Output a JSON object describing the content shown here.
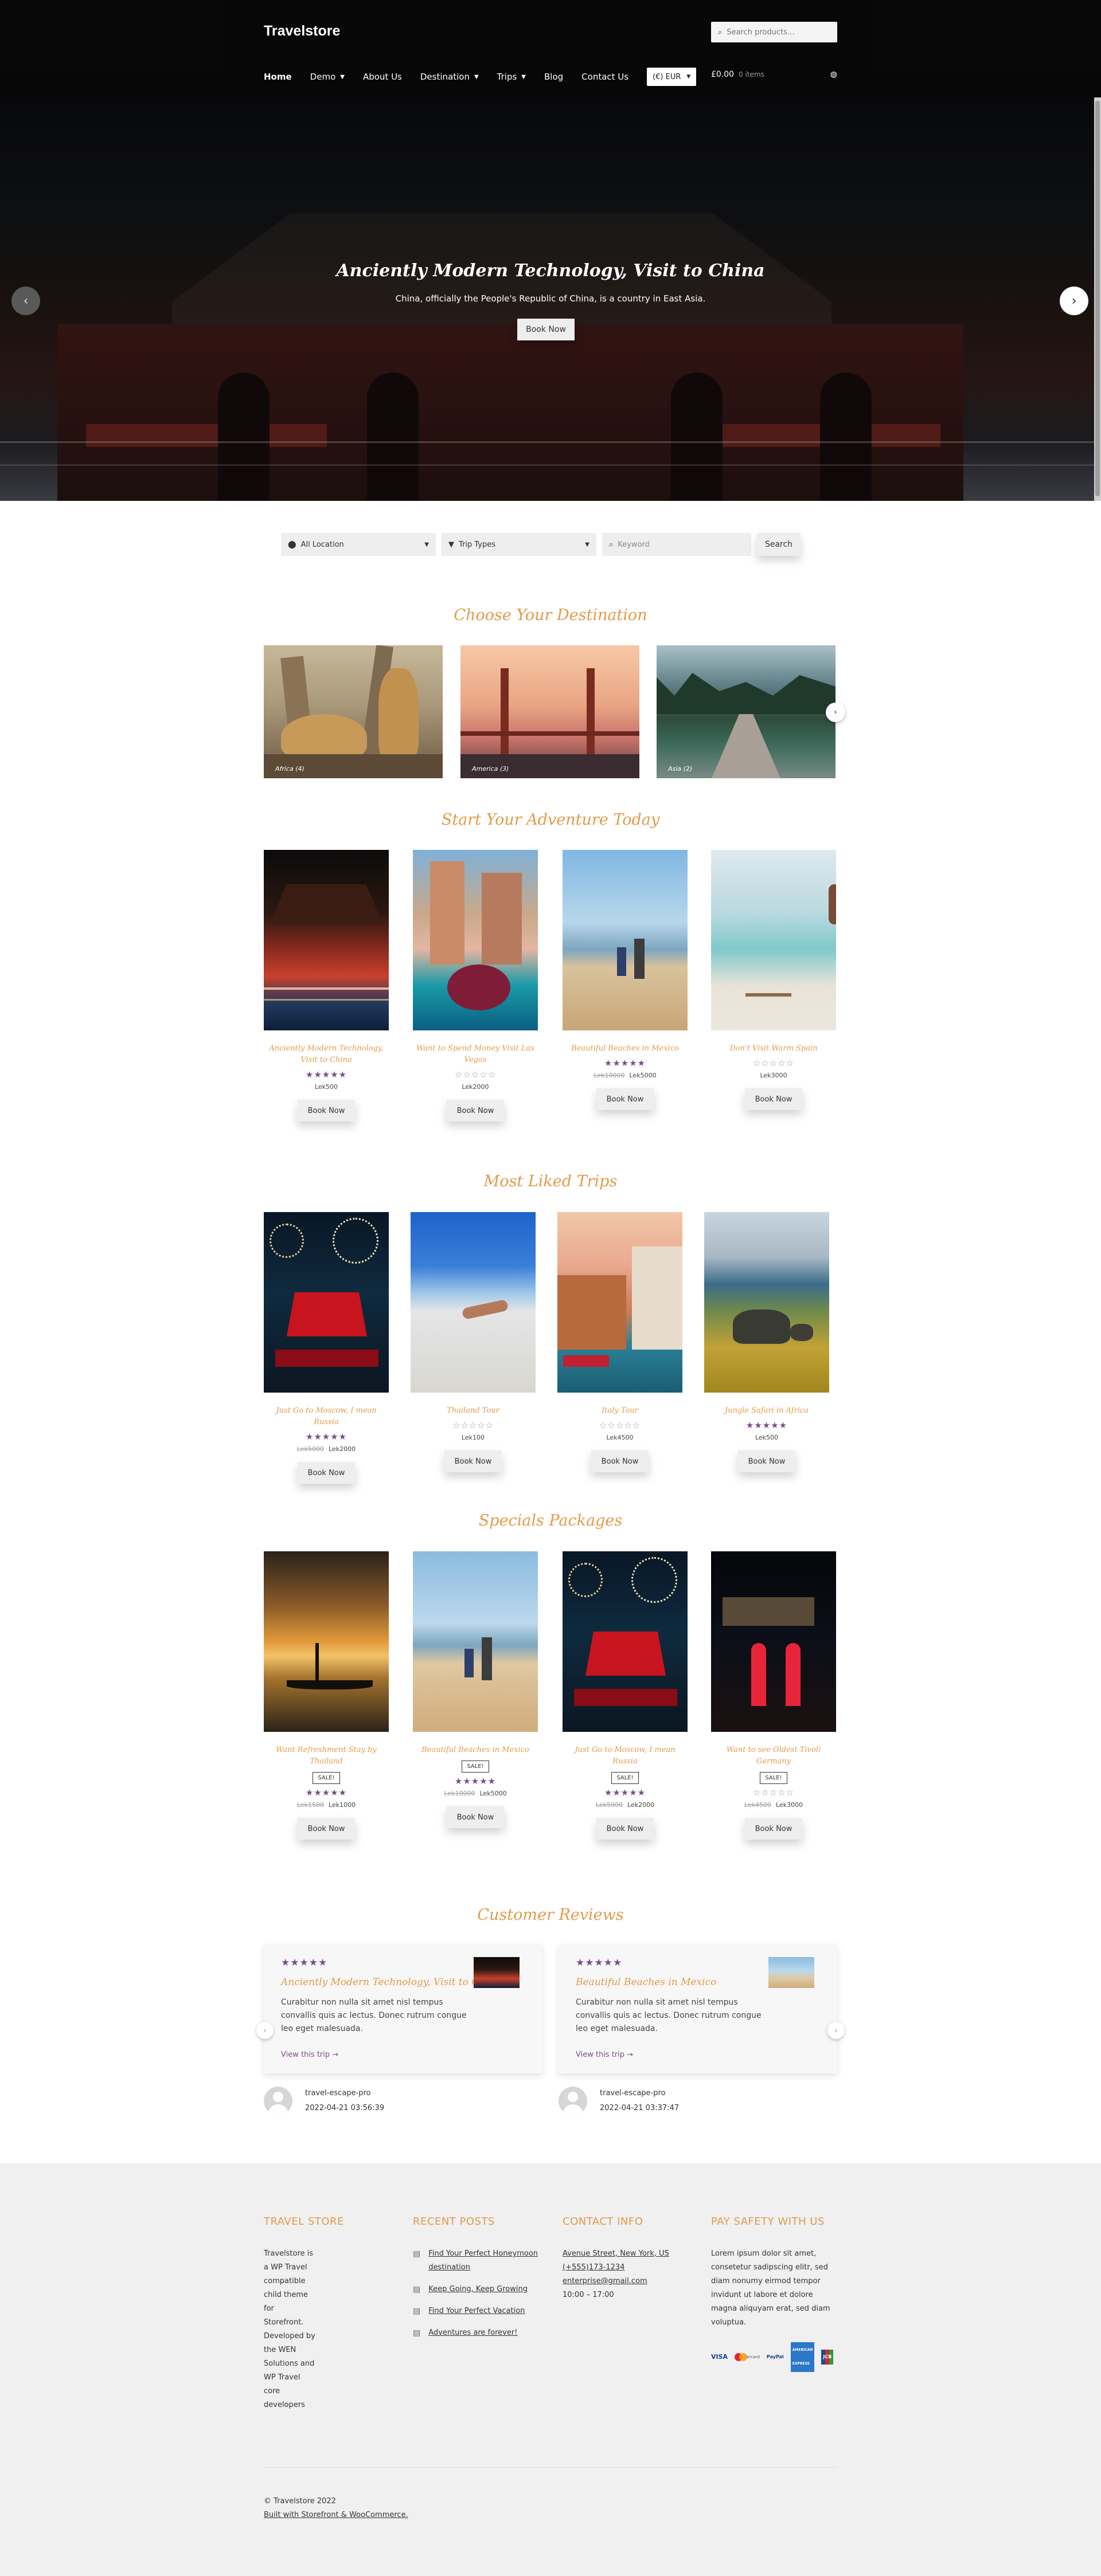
{
  "header": {
    "logo": "Travelstore",
    "search_placeholder": "Search products…",
    "nav": [
      {
        "label": "Home",
        "dropdown": false,
        "active": true
      },
      {
        "label": "Demo",
        "dropdown": true
      },
      {
        "label": "About Us",
        "dropdown": false
      },
      {
        "label": "Destination",
        "dropdown": true
      },
      {
        "label": "Trips",
        "dropdown": true
      },
      {
        "label": "Blog",
        "dropdown": false
      },
      {
        "label": "Contact Us",
        "dropdown": false
      }
    ],
    "currency": "(€) EUR",
    "cart_total": "£0.00",
    "cart_items": "0 items"
  },
  "hero": {
    "title": "Anciently Modern Technology, Visit to China",
    "subtitle": "China, officially the People's Republic of China, is a country in East Asia.",
    "button": "Book Now",
    "prev_icon": "‹",
    "next_icon": "›"
  },
  "filters": {
    "location": "All Location",
    "trip_types": "Trip Types",
    "keyword_placeholder": "Keyword",
    "search_button": "Search"
  },
  "destinations": {
    "title": "Choose Your Destination",
    "items": [
      {
        "label": "Africa (4)"
      },
      {
        "label": "America (3)"
      },
      {
        "label": "Asia (2)"
      }
    ]
  },
  "adventure": {
    "title": "Start Your Adventure Today",
    "cards": [
      {
        "name": "Anciently Modern Technology, Visit to China",
        "stars": "★★★★★",
        "rated": true,
        "old_price": "",
        "price": "Lek500",
        "sale": "",
        "button": "Book Now"
      },
      {
        "name": "Want to Spend Money Visit Las Vegas",
        "stars": "☆☆☆☆☆",
        "rated": false,
        "old_price": "",
        "price": "Lek2000",
        "sale": "",
        "button": "Book Now"
      },
      {
        "name": "Beautiful Beaches in Mexico",
        "stars": "★★★★★",
        "rated": true,
        "old_price": "Lek10000",
        "price": "Lek5000",
        "sale": "",
        "button": "Book Now"
      },
      {
        "name": "Don't Visit Warm Spain",
        "stars": "☆☆☆☆☆",
        "rated": false,
        "old_price": "",
        "price": "Lek3000",
        "sale": "",
        "button": "Book Now"
      }
    ]
  },
  "most_liked": {
    "title": "Most Liked Trips",
    "cards": [
      {
        "name": "Just Go to Moscow, I mean Russia",
        "stars": "★★★★★",
        "rated": true,
        "old_price": "Lek5000",
        "price": "Lek2000",
        "sale": "",
        "button": "Book Now"
      },
      {
        "name": "Thailand Tour",
        "stars": "☆☆☆☆☆",
        "rated": false,
        "old_price": "",
        "price": "Lek100",
        "sale": "",
        "button": "Book Now"
      },
      {
        "name": "Italy Tour",
        "stars": "☆☆☆☆☆",
        "rated": false,
        "old_price": "",
        "price": "Lek4500",
        "sale": "",
        "button": "Book Now"
      },
      {
        "name": "Jungle Safari in Africa",
        "stars": "★★★★★",
        "rated": true,
        "old_price": "",
        "price": "Lek500",
        "sale": "",
        "button": "Book Now"
      }
    ]
  },
  "specials": {
    "title": "Specials Packages",
    "cards": [
      {
        "name": "Want Refreshment Stay by Thailand",
        "stars": "★★★★★",
        "rated": true,
        "old_price": "Lek1500",
        "price": "Lek1000",
        "sale": "SALE!",
        "button": "Book Now"
      },
      {
        "name": "Beautiful Beaches in Mexico",
        "stars": "★★★★★",
        "rated": true,
        "old_price": "Lek10000",
        "price": "Lek5000",
        "sale": "SALE!",
        "button": "Book Now"
      },
      {
        "name": "Just Go to Moscow, I mean Russia",
        "stars": "★★★★★",
        "rated": true,
        "old_price": "Lek5000",
        "price": "Lek2000",
        "sale": "SALE!",
        "button": "Book Now"
      },
      {
        "name": "Want to see Oldest Tivoli Germany",
        "stars": "☆☆☆☆☆",
        "rated": false,
        "old_price": "Lek4500",
        "price": "Lek3000",
        "sale": "SALE!",
        "button": "Book Now"
      }
    ]
  },
  "reviews": {
    "title": "Customer Reviews",
    "items": [
      {
        "stars": "★★★★★",
        "trip": "Anciently Modern Technology, Visit to China",
        "text": "Curabitur non nulla sit amet nisl tempus convallis quis ac lectus. Donec rutrum congue leo eget malesuada.",
        "link": "View this trip →",
        "author": "travel-escape-pro",
        "date": "2022-04-21 03:56:39"
      },
      {
        "stars": "★★★★★",
        "trip": "Beautiful Beaches in Mexico",
        "text": "Curabitur non nulla sit amet nisl tempus convallis quis ac lectus. Donec rutrum congue leo eget malesuada.",
        "link": "View this trip →",
        "author": "travel-escape-pro",
        "date": "2022-04-21 03:37:47"
      }
    ]
  },
  "footer": {
    "about_title": "TRAVEL STORE",
    "about_text": "Travelstore is a WP Travel compatible child theme for Storefront. Developed by the WEN Solutions and WP Travel core developers",
    "posts_title": "RECENT POSTS",
    "posts": [
      "Find Your Perfect Honeymoon destination",
      "Keep Going, Keep Growing",
      "Find Your Perfect Vacation",
      "Adventures are forever!"
    ],
    "contact_title": "CONTACT INFO",
    "address": "Avenue Street, New York, US",
    "phone": "(+555)173-1234",
    "email": "enterprise@gmail.com",
    "hours": "10:00 – 17:00",
    "safety_title": "PAY SAFETY WITH US",
    "safety_text": "Lorem ipsum dolor sit amet, consetetur sadipscing elitr, sed diam nonumy eirmod tempor invidunt ut labore et dolore magna aliquyam erat, sed diam voluptua.",
    "payments": [
      "VISA",
      "mastercard",
      "PayPal",
      "AMERICAN EXPRESS",
      "JCB"
    ],
    "copyright": "© Travelstore 2022",
    "built_with": "Built with Storefront & WooCommerce."
  },
  "colors": {
    "accent": "#e39a4a",
    "star": "#7b4c8c",
    "header_bg": "#0c0c0c",
    "footer_bg": "#f0f0f0"
  }
}
